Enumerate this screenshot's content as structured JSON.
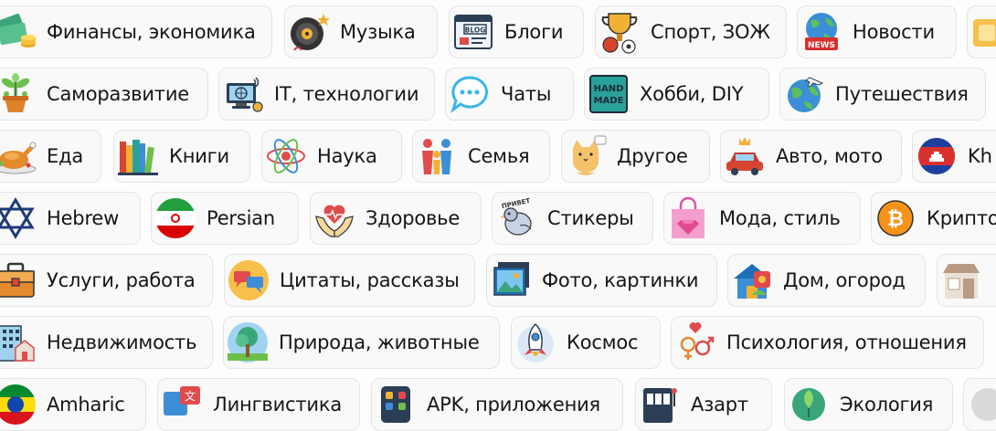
{
  "categories": {
    "row1": [
      {
        "label": "Финансы, экономика",
        "icon": "money-icon"
      },
      {
        "label": "Музыка",
        "icon": "vinyl-record-icon"
      },
      {
        "label": "Блоги",
        "icon": "blog-browser-icon"
      },
      {
        "label": "Спорт, ЗОЖ",
        "icon": "trophy-icon"
      },
      {
        "label": "Новости",
        "icon": "news-globe-icon"
      },
      {
        "label": "",
        "icon": "partial-icon"
      }
    ],
    "row2": [
      {
        "label": "Саморазвитие",
        "icon": "plant-pot-icon"
      },
      {
        "label": "IT, технологии",
        "icon": "computer-network-icon"
      },
      {
        "label": "Чаты",
        "icon": "chat-bubble-icon"
      },
      {
        "label": "Хобби, DIY",
        "icon": "handmade-icon"
      },
      {
        "label": "Путешествия",
        "icon": "globe-plane-icon"
      }
    ],
    "row3": [
      {
        "label": "Еда",
        "icon": "roast-chicken-icon"
      },
      {
        "label": "Книги",
        "icon": "books-icon"
      },
      {
        "label": "Наука",
        "icon": "atom-icon"
      },
      {
        "label": "Семья",
        "icon": "family-icon"
      },
      {
        "label": "Другое",
        "icon": "cat-icon"
      },
      {
        "label": "Авто, мото",
        "icon": "car-crown-icon"
      },
      {
        "label": "Kh",
        "icon": "cambodia-flag-icon"
      }
    ],
    "row4": [
      {
        "label": "Hebrew",
        "icon": "star-of-david-icon"
      },
      {
        "label": "Persian",
        "icon": "iran-flag-icon"
      },
      {
        "label": "Здоровье",
        "icon": "heart-hands-icon"
      },
      {
        "label": "Стикеры",
        "icon": "pigeon-sticker-icon"
      },
      {
        "label": "Мода, стиль",
        "icon": "shopping-bag-diamond-icon"
      },
      {
        "label": "Крипто",
        "icon": "bitcoin-icon"
      }
    ],
    "row5": [
      {
        "label": "Услуги, работа",
        "icon": "briefcase-icon"
      },
      {
        "label": "Цитаты, рассказы",
        "icon": "quote-bubbles-icon"
      },
      {
        "label": "Фото, картинки",
        "icon": "photos-icon"
      },
      {
        "label": "Дом, огород",
        "icon": "house-garden-icon"
      },
      {
        "label": "",
        "icon": "shop-icon"
      }
    ],
    "row6": [
      {
        "label": "Недвижимость",
        "icon": "buildings-icon"
      },
      {
        "label": "Природа, животные",
        "icon": "tree-icon"
      },
      {
        "label": "Космос",
        "icon": "rocket-icon"
      },
      {
        "label": "Психология, отношения",
        "icon": "gender-hearts-icon"
      }
    ],
    "row7": [
      {
        "label": "Amharic",
        "icon": "ethiopia-flag-icon"
      },
      {
        "label": "Лингвистика",
        "icon": "translate-icon"
      },
      {
        "label": "APK, приложения",
        "icon": "apps-icon"
      },
      {
        "label": "Азарт",
        "icon": "slot-machine-icon"
      },
      {
        "label": "Экология",
        "icon": "eco-globe-icon"
      }
    ]
  },
  "icon_text": {
    "blog": "BLOG",
    "news": "NEWS",
    "handmade_1": "HAND",
    "handmade_2": "MADE",
    "sticker": "ПРИВЕТ",
    "translate": "文"
  }
}
